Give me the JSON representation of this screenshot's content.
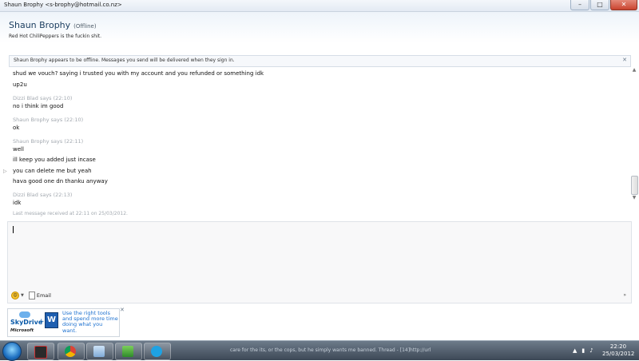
{
  "window": {
    "title": "Shaun Brophy <s-brophy@hotmail.co.nz>",
    "controls": {
      "minimize": "–",
      "maximize": "□",
      "close": "✕"
    }
  },
  "header": {
    "contact_name": "Shaun Brophy",
    "status": "(Offline)",
    "personal_message": "Red Hot ChiliPeppers is the fuckin shit."
  },
  "banner": {
    "text": "Shaun Brophy appears to be offline. Messages you send will be delivered when they sign in.",
    "close": "✕"
  },
  "conversation": {
    "lines": [
      {
        "type": "message",
        "text": "shud we vouch? saying i trusted you with my account and you refunded or something idk"
      },
      {
        "type": "message",
        "text": "up2u"
      },
      {
        "type": "sender",
        "text": "Dizzi Blad says (22:10)"
      },
      {
        "type": "message",
        "text": "no i think im good"
      },
      {
        "type": "sender",
        "text": "Shaun Brophy says (22:10)"
      },
      {
        "type": "message",
        "text": "ok"
      },
      {
        "type": "sender",
        "text": "Shaun Brophy says (22:11)"
      },
      {
        "type": "message",
        "text": "well"
      },
      {
        "type": "message",
        "text": "ill keep you added just incase"
      },
      {
        "type": "message",
        "text": "you can delete me but yeah"
      },
      {
        "type": "message",
        "text": "hava good one dn thanku anyway"
      },
      {
        "type": "sender",
        "text": "Dizzi Blad says (22:13)"
      },
      {
        "type": "message",
        "text": "idk"
      },
      {
        "type": "meta",
        "text": "Last message received at 22:11 on 25/03/2012."
      }
    ],
    "collapse_arrow": "▷"
  },
  "scrollbar": {
    "up": "▲",
    "down": "▼"
  },
  "compose": {
    "emoticon": "☺",
    "emoticon_dropdown": "▼",
    "email_label": "Email",
    "expand": "»"
  },
  "ad": {
    "brand": "SkyDrive",
    "plus": "+",
    "word_letter": "W",
    "text": "Use the right tools and spend more time doing what you want.",
    "microsoft": "Microsoft",
    "close": "✕"
  },
  "taskbar": {
    "tray_text": "care for the its, or the cops, but he simply wants me banned.  Thread - [14]http://url",
    "tray_icons": [
      "▲",
      "▮",
      "♪"
    ],
    "time": "22:20",
    "date": "25/03/2012"
  }
}
